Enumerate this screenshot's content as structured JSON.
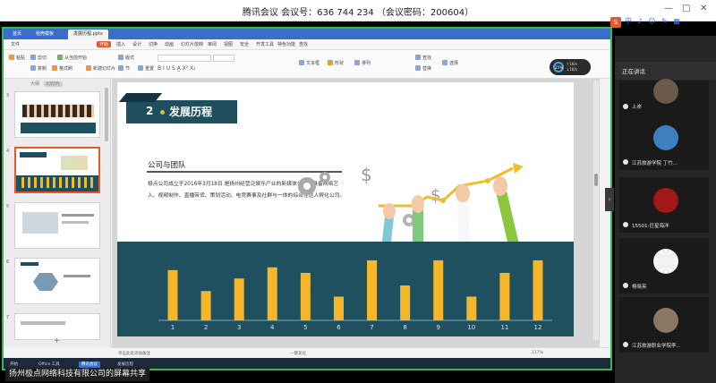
{
  "meeting": {
    "title": "腾讯会议 会议号：636 744 234 （会议密码：200604）",
    "controls": [
      "—",
      "□",
      "✕"
    ]
  },
  "wps": {
    "tabs": [
      "首页",
      "稻壳模板",
      "发展历程.pptx"
    ],
    "menu": [
      "文件",
      "开始",
      "插入",
      "设计",
      "切换",
      "动画",
      "幻灯片放映",
      "审阅",
      "视图",
      "安全",
      "开发工具",
      "特色功能",
      "查找"
    ],
    "active_menu": "开始",
    "toolbar": {
      "paste": "粘贴",
      "cut": "剪切",
      "copy": "复制",
      "format_painter": "格式刷",
      "from_current": "从当前开始",
      "new_slide": "新建幻灯片",
      "layout": "版式",
      "section": "节",
      "reset": "重置",
      "text_box": "文本框",
      "shapes": "形状",
      "arrange": "排列",
      "find": "查找",
      "replace": "替换",
      "select": "选择"
    },
    "speed": {
      "percent": "25%",
      "lines": [
        "↑1K/s",
        "↓1K/s"
      ]
    },
    "thumb_panel": {
      "tabs": [
        "大纲",
        "幻灯片"
      ],
      "selected_tab": "幻灯片",
      "numbers": [
        "3",
        "4",
        "5",
        "6",
        "7"
      ],
      "add_label": "+"
    },
    "status": {
      "notes": "单击此处添加备注",
      "middle": "一键美化",
      "zoom": "117%"
    },
    "taskbar": [
      "开始",
      "Office 工具",
      "腾讯会议",
      "发展历程"
    ],
    "active_task": "腾讯会议"
  },
  "slide": {
    "section_number": "2",
    "section_title": "发展历程",
    "subtitle": "公司与团队",
    "paragraph": "极点公司成立于2016年3月18日 是扬州经营泛娱乐产业的新媒体公司，具备网络艺人、视频制作、直播带货、策划活动、电竞赛事及社群与一体的综合性达人孵化公司。"
  },
  "chart_data": {
    "type": "bar",
    "categories": [
      "1",
      "2",
      "3",
      "4",
      "5",
      "6",
      "7",
      "8",
      "9",
      "10",
      "11",
      "12"
    ],
    "values": [
      72,
      42,
      60,
      76,
      68,
      34,
      86,
      50,
      86,
      34,
      68,
      86
    ],
    "ylim": [
      0,
      100
    ],
    "bar_color": "#f5b62a",
    "background": "#1f5060",
    "title": "",
    "xlabel": "",
    "ylabel": ""
  },
  "share_banner": "扬州极点网络科技有限公司的屏幕共享",
  "participants": {
    "status": "正在讲话",
    "people": [
      {
        "name": "上岸",
        "avatar_color": "#6b5a4a"
      },
      {
        "name": "江苏旅游学院 丁竹...",
        "avatar_color": "#3f7fbf"
      },
      {
        "name": "15501-巨星海洋",
        "avatar_color": "#a01818"
      },
      {
        "name": "杨晓英",
        "avatar_color": "#f2f2f2"
      },
      {
        "name": "江苏旅游职业学院李...",
        "avatar_color": "#8a7766"
      }
    ]
  },
  "colors": {
    "accent_green": "#2dbf4e",
    "wps_blue": "#3a6fc9",
    "header_teal": "#1f4f5f",
    "gold": "#f4b728"
  }
}
